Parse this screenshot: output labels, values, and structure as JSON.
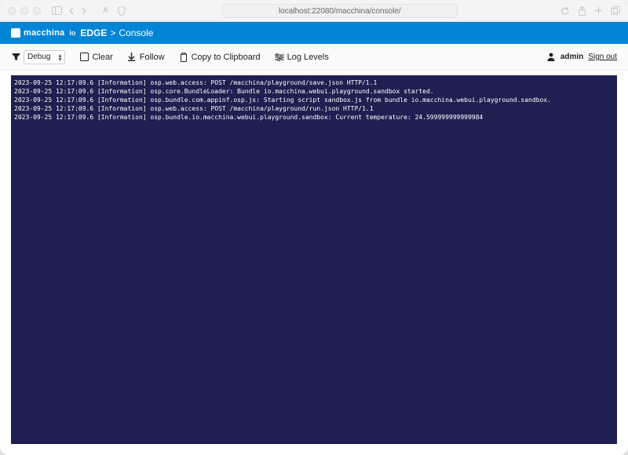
{
  "browser": {
    "url": "localhost:22080/macchina/console/"
  },
  "header": {
    "brand_name": "macchina",
    "brand_sub": "io",
    "edge": "EDGE",
    "crumb_sep": ">",
    "crumb": "Console"
  },
  "toolbar": {
    "level_selected": "Debug",
    "clear": "Clear",
    "follow": "Follow",
    "copy": "Copy to Clipboard",
    "loglevels": "Log Levels"
  },
  "user": {
    "name": "admin",
    "signout": "Sign out"
  },
  "log_lines": [
    "2023-09-25 12:17:09.6 [Information] osp.web.access: POST /macchina/playground/save.json HTTP/1.1",
    "2023-09-25 12:17:09.6 [Information] osp.core.BundleLoader: Bundle io.macchina.webui.playground.sandbox started.",
    "2023-09-25 12:17:09.6 [Information] osp.bundle.com.appinf.osp.js: Starting script sandbox.js from bundle io.macchina.webui.playground.sandbox.",
    "2023-09-25 12:17:09.6 [Information] osp.web.access: POST /macchina/playground/run.json HTTP/1.1",
    "2023-09-25 12:17:09.6 [Information] osp.bundle.io.macchina.webui.playground.sandbox: Current temperature: 24.599999999999984"
  ]
}
